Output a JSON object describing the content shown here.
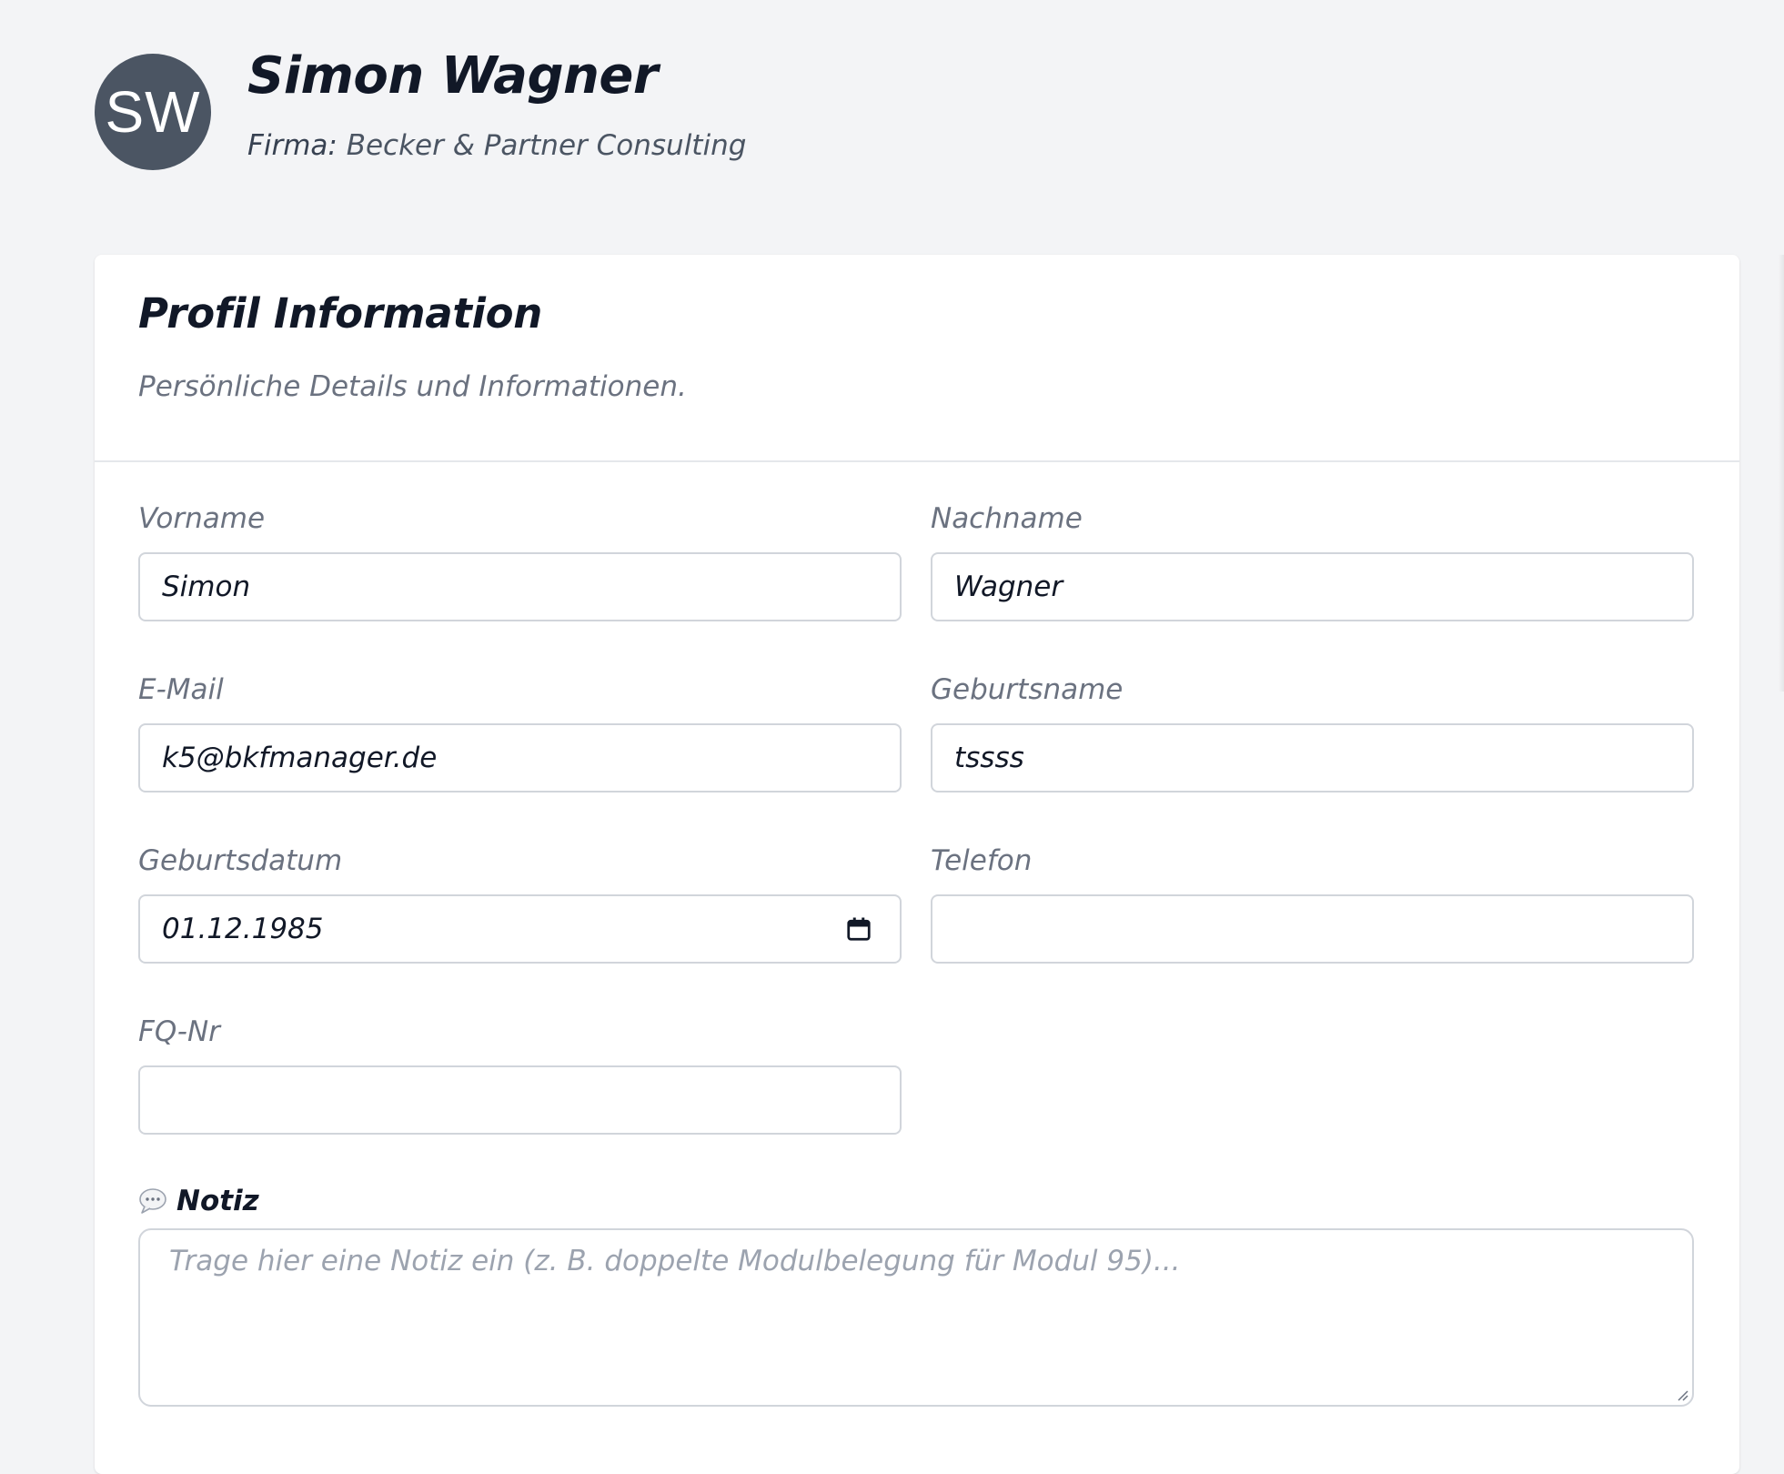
{
  "profile": {
    "initials": "SW",
    "name": "Simon Wagner",
    "company_label": "Firma:",
    "company_name": "Becker & Partner Consulting"
  },
  "card": {
    "title": "Profil Information",
    "subtitle": "Persönliche Details und Informationen."
  },
  "fields": {
    "vorname": {
      "label": "Vorname",
      "value": "Simon"
    },
    "nachname": {
      "label": "Nachname",
      "value": "Wagner"
    },
    "email": {
      "label": "E-Mail",
      "value": "k5@bkfmanager.de"
    },
    "geburtsname": {
      "label": "Geburtsname",
      "value": "tssss"
    },
    "geburtsdatum": {
      "label": "Geburtsdatum",
      "value": "01.12.1985"
    },
    "telefon": {
      "label": "Telefon",
      "value": ""
    },
    "fq_nr": {
      "label": "FQ-Nr",
      "value": ""
    }
  },
  "notiz": {
    "label": "Notiz",
    "placeholder": "Trage hier eine Notiz ein (z. B. doppelte Modulbelegung für Modul 95)..."
  },
  "icons": {
    "date": "calendar-icon",
    "note": "speech-bubble-icon",
    "resize": "resize-handle-icon"
  },
  "colors": {
    "avatar_bg": "#4b5563",
    "page_bg": "#f3f4f6",
    "card_bg": "#ffffff",
    "border": "#d1d5db",
    "label": "#6b7280"
  }
}
